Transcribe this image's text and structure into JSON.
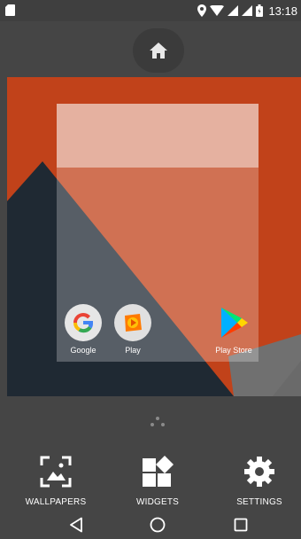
{
  "status_bar": {
    "time": "13:18",
    "icons": [
      "sd-card-icon",
      "location-icon",
      "wifi-icon",
      "signal-icon",
      "signal-icon-2",
      "battery-icon"
    ]
  },
  "home_indicator": {
    "icon": "home-icon"
  },
  "workspace": {
    "apps": [
      {
        "label": "Google",
        "icon": "google-icon"
      },
      {
        "label": "Play",
        "icon": "play-music-icon"
      },
      {
        "label": "Play Store",
        "icon": "play-store-icon"
      }
    ]
  },
  "options": {
    "wallpapers": "WALLPAPERS",
    "widgets": "WIDGETS",
    "settings": "SETTINGS"
  },
  "nav": {
    "back": "back-icon",
    "home": "home-circle-icon",
    "recents": "recents-icon"
  },
  "colors": {
    "wallpaper_orange": "#c1421a",
    "wallpaper_dark": "#1f2933",
    "wallpaper_grey": "#6f6f6f",
    "background": "#454545"
  }
}
